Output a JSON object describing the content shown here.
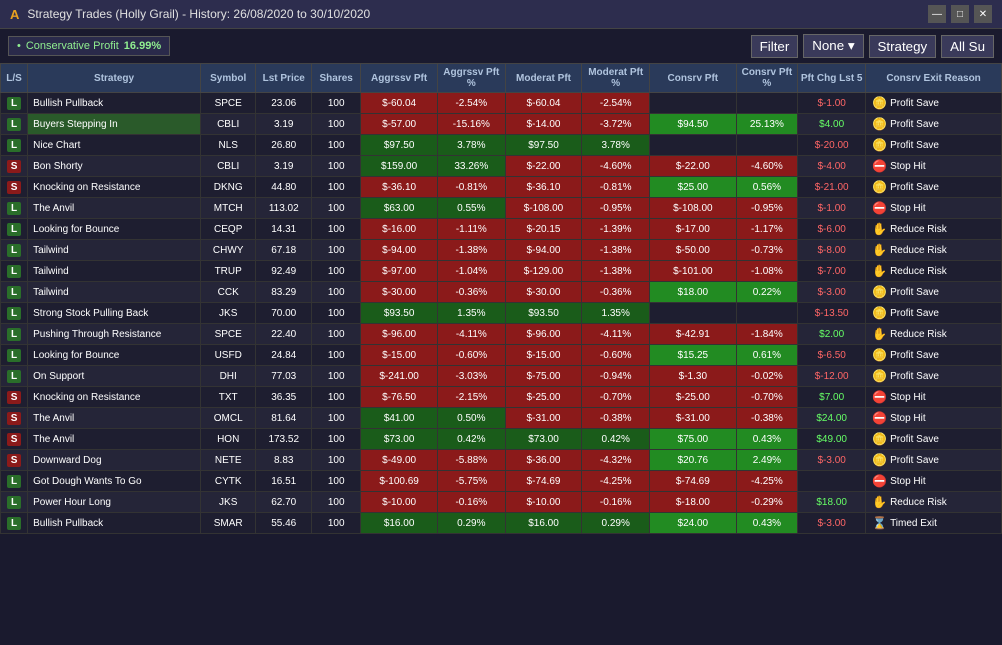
{
  "titleBar": {
    "icon": "A",
    "title": "Strategy Trades (Holly Grail) - History: 26/08/2020 to 30/10/2020",
    "minimize": "—",
    "maximize": "□",
    "close": "✕"
  },
  "toolbar": {
    "dotLabel": "•",
    "conservativeLabel": "Conservative Profit",
    "profitValue": "16.99%",
    "filterLabel": "Filter",
    "noneLabel": "None ▾",
    "strategyLabel": "Strategy",
    "allLabel": "All Su"
  },
  "headers": {
    "ls": "L/S",
    "strategy": "Strategy",
    "symbol": "Symbol",
    "lstPrice": "Lst Price",
    "shares": "Shares",
    "aggrPft": "Aggrssv Pft",
    "aggrPct": "Aggrssv Pft %",
    "modPft": "Moderat Pft",
    "modPct": "Moderat Pft %",
    "consPft": "Consrv Pft",
    "consPct": "Consrv Pft %",
    "pftChg": "Pft Chg Lst 5",
    "exitReason": "Consrv Exit Reason"
  },
  "rows": [
    {
      "ls": "L",
      "strategy": "Bullish Pullback",
      "symbol": "SPCE",
      "price": "23.06",
      "shares": "100",
      "aggrPft": "$-60.04",
      "aggrPct": "-2.54%",
      "modPft": "$-60.04",
      "modPct": "-2.54%",
      "consPft": "",
      "consPct": "",
      "pftChg": "$-1.00",
      "exitIcon": "profit",
      "exitLabel": "Profit Save",
      "aggrRed": true,
      "modRed": true
    },
    {
      "ls": "L",
      "strategy": "Buyers Stepping In",
      "symbol": "CBLI",
      "price": "3.19",
      "shares": "100",
      "aggrPft": "$-57.00",
      "aggrPct": "-15.16%",
      "modPft": "$-14.00",
      "modPct": "-3.72%",
      "consPft": "$94.50",
      "consPct": "25.13%",
      "pftChg": "$4.00",
      "exitIcon": "profit",
      "exitLabel": "Profit Save",
      "aggrRed": true,
      "modRed": true,
      "consGreen": true,
      "highlighted": true
    },
    {
      "ls": "L",
      "strategy": "Nice Chart",
      "symbol": "NLS",
      "price": "26.80",
      "shares": "100",
      "aggrPft": "$97.50",
      "aggrPct": "3.78%",
      "modPft": "$97.50",
      "modPct": "3.78%",
      "consPft": "",
      "consPct": "",
      "pftChg": "$-20.00",
      "exitIcon": "profit",
      "exitLabel": "Profit Save",
      "aggrGreen": true,
      "modGreen": true
    },
    {
      "ls": "S",
      "strategy": "Bon Shorty",
      "symbol": "CBLI",
      "price": "3.19",
      "shares": "100",
      "aggrPft": "$159.00",
      "aggrPct": "33.26%",
      "modPft": "$-22.00",
      "modPct": "-4.60%",
      "consPft": "$-22.00",
      "consPct": "-4.60%",
      "pftChg": "$-4.00",
      "exitIcon": "stop",
      "exitLabel": "Stop Hit",
      "aggrGreen": true,
      "modRed": true,
      "consRed": true
    },
    {
      "ls": "S",
      "strategy": "Knocking on Resistance",
      "symbol": "DKNG",
      "price": "44.80",
      "shares": "100",
      "aggrPft": "$-36.10",
      "aggrPct": "-0.81%",
      "modPft": "$-36.10",
      "modPct": "-0.81%",
      "consPft": "$25.00",
      "consPct": "0.56%",
      "pftChg": "$-21.00",
      "exitIcon": "profit",
      "exitLabel": "Profit Save",
      "aggrRed": true,
      "modRed": true,
      "consGreen": true
    },
    {
      "ls": "L",
      "strategy": "The Anvil",
      "symbol": "MTCH",
      "price": "113.02",
      "shares": "100",
      "aggrPft": "$63.00",
      "aggrPct": "0.55%",
      "modPft": "$-108.00",
      "modPct": "-0.95%",
      "consPft": "$-108.00",
      "consPct": "-0.95%",
      "pftChg": "$-1.00",
      "exitIcon": "stop",
      "exitLabel": "Stop Hit",
      "aggrGreen": true,
      "modRed": true,
      "consRed": true
    },
    {
      "ls": "L",
      "strategy": "Looking for Bounce",
      "symbol": "CEQP",
      "price": "14.31",
      "shares": "100",
      "aggrPft": "$-16.00",
      "aggrPct": "-1.11%",
      "modPft": "$-20.15",
      "modPct": "-1.39%",
      "consPft": "$-17.00",
      "consPct": "-1.17%",
      "pftChg": "$-6.00",
      "exitIcon": "reduce",
      "exitLabel": "Reduce Risk",
      "aggrRed": true,
      "modRed": true,
      "consRed": true
    },
    {
      "ls": "L",
      "strategy": "Tailwind",
      "symbol": "CHWY",
      "price": "67.18",
      "shares": "100",
      "aggrPft": "$-94.00",
      "aggrPct": "-1.38%",
      "modPft": "$-94.00",
      "modPct": "-1.38%",
      "consPft": "$-50.00",
      "consPct": "-0.73%",
      "pftChg": "$-8.00",
      "exitIcon": "reduce",
      "exitLabel": "Reduce Risk",
      "aggrRed": true,
      "modRed": true,
      "consRed": true
    },
    {
      "ls": "L",
      "strategy": "Tailwind",
      "symbol": "TRUP",
      "price": "92.49",
      "shares": "100",
      "aggrPft": "$-97.00",
      "aggrPct": "-1.04%",
      "modPft": "$-129.00",
      "modPct": "-1.38%",
      "consPft": "$-101.00",
      "consPct": "-1.08%",
      "pftChg": "$-7.00",
      "exitIcon": "reduce",
      "exitLabel": "Reduce Risk",
      "aggrRed": true,
      "modRed": true,
      "consRed": true
    },
    {
      "ls": "L",
      "strategy": "Tailwind",
      "symbol": "CCK",
      "price": "83.29",
      "shares": "100",
      "aggrPft": "$-30.00",
      "aggrPct": "-0.36%",
      "modPft": "$-30.00",
      "modPct": "-0.36%",
      "consPft": "$18.00",
      "consPct": "0.22%",
      "pftChg": "$-3.00",
      "exitIcon": "profit",
      "exitLabel": "Profit Save",
      "aggrRed": true,
      "modRed": true,
      "consGreen": true
    },
    {
      "ls": "L",
      "strategy": "Strong Stock Pulling Back",
      "symbol": "JKS",
      "price": "70.00",
      "shares": "100",
      "aggrPft": "$93.50",
      "aggrPct": "1.35%",
      "modPft": "$93.50",
      "modPct": "1.35%",
      "consPft": "",
      "consPct": "",
      "pftChg": "$-13.50",
      "exitIcon": "profit",
      "exitLabel": "Profit Save",
      "aggrGreen": true,
      "modGreen": true
    },
    {
      "ls": "L",
      "strategy": "Pushing Through Resistance",
      "symbol": "SPCE",
      "price": "22.40",
      "shares": "100",
      "aggrPft": "$-96.00",
      "aggrPct": "-4.11%",
      "modPft": "$-96.00",
      "modPct": "-4.11%",
      "consPft": "$-42.91",
      "consPct": "-1.84%",
      "pftChg": "$2.00",
      "exitIcon": "reduce",
      "exitLabel": "Reduce Risk",
      "aggrRed": true,
      "modRed": true,
      "consRed": true
    },
    {
      "ls": "L",
      "strategy": "Looking for Bounce",
      "symbol": "USFD",
      "price": "24.84",
      "shares": "100",
      "aggrPft": "$-15.00",
      "aggrPct": "-0.60%",
      "modPft": "$-15.00",
      "modPct": "-0.60%",
      "consPft": "$15.25",
      "consPct": "0.61%",
      "pftChg": "$-6.50",
      "exitIcon": "profit",
      "exitLabel": "Profit Save",
      "aggrRed": true,
      "modRed": true,
      "consGreen": true
    },
    {
      "ls": "L",
      "strategy": "On Support",
      "symbol": "DHI",
      "price": "77.03",
      "shares": "100",
      "aggrPft": "$-241.00",
      "aggrPct": "-3.03%",
      "modPft": "$-75.00",
      "modPct": "-0.94%",
      "consPft": "$-1.30",
      "consPct": "-0.02%",
      "pftChg": "$-12.00",
      "exitIcon": "profit",
      "exitLabel": "Profit Save",
      "aggrRed": true,
      "modRed": true,
      "consRed": true
    },
    {
      "ls": "S",
      "strategy": "Knocking on Resistance",
      "symbol": "TXT",
      "price": "36.35",
      "shares": "100",
      "aggrPft": "$-76.50",
      "aggrPct": "-2.15%",
      "modPft": "$-25.00",
      "modPct": "-0.70%",
      "consPft": "$-25.00",
      "consPct": "-0.70%",
      "pftChg": "$7.00",
      "exitIcon": "stop",
      "exitLabel": "Stop Hit",
      "aggrRed": true,
      "modRed": true,
      "consRed": true
    },
    {
      "ls": "S",
      "strategy": "The Anvil",
      "symbol": "OMCL",
      "price": "81.64",
      "shares": "100",
      "aggrPft": "$41.00",
      "aggrPct": "0.50%",
      "modPft": "$-31.00",
      "modPct": "-0.38%",
      "consPft": "$-31.00",
      "consPct": "-0.38%",
      "pftChg": "$24.00",
      "exitIcon": "stop",
      "exitLabel": "Stop Hit",
      "aggrGreen": true,
      "modRed": true,
      "consRed": true
    },
    {
      "ls": "S",
      "strategy": "The Anvil",
      "symbol": "HON",
      "price": "173.52",
      "shares": "100",
      "aggrPft": "$73.00",
      "aggrPct": "0.42%",
      "modPft": "$73.00",
      "modPct": "0.42%",
      "consPft": "$75.00",
      "consPct": "0.43%",
      "pftChg": "$49.00",
      "exitIcon": "profit",
      "exitLabel": "Profit Save",
      "aggrGreen": true,
      "modGreen": true,
      "consGreen": true
    },
    {
      "ls": "S",
      "strategy": "Downward Dog",
      "symbol": "NETE",
      "price": "8.83",
      "shares": "100",
      "aggrPft": "$-49.00",
      "aggrPct": "-5.88%",
      "modPft": "$-36.00",
      "modPct": "-4.32%",
      "consPft": "$20.76",
      "consPct": "2.49%",
      "pftChg": "$-3.00",
      "exitIcon": "profit",
      "exitLabel": "Profit Save",
      "aggrRed": true,
      "modRed": true,
      "consGreen": true
    },
    {
      "ls": "L",
      "strategy": "Got Dough Wants To Go",
      "symbol": "CYTK",
      "price": "16.51",
      "shares": "100",
      "aggrPft": "$-100.69",
      "aggrPct": "-5.75%",
      "modPft": "$-74.69",
      "modPct": "-4.25%",
      "consPft": "$-74.69",
      "consPct": "-4.25%",
      "pftChg": "",
      "exitIcon": "stop",
      "exitLabel": "Stop Hit",
      "aggrRed": true,
      "modRed": true,
      "consRed": true
    },
    {
      "ls": "L",
      "strategy": "Power Hour Long",
      "symbol": "JKS",
      "price": "62.70",
      "shares": "100",
      "aggrPft": "$-10.00",
      "aggrPct": "-0.16%",
      "modPft": "$-10.00",
      "modPct": "-0.16%",
      "consPft": "$-18.00",
      "consPct": "-0.29%",
      "pftChg": "$18.00",
      "exitIcon": "reduce",
      "exitLabel": "Reduce Risk",
      "aggrRed": true,
      "modRed": true,
      "consRed": true
    },
    {
      "ls": "L",
      "strategy": "Bullish Pullback",
      "symbol": "SMAR",
      "price": "55.46",
      "shares": "100",
      "aggrPft": "$16.00",
      "aggrPct": "0.29%",
      "modPft": "$16.00",
      "modPct": "0.29%",
      "consPft": "$24.00",
      "consPct": "0.43%",
      "pftChg": "$-3.00",
      "exitIcon": "timed",
      "exitLabel": "Timed Exit",
      "aggrGreen": true,
      "modGreen": true,
      "consGreen": true
    }
  ]
}
